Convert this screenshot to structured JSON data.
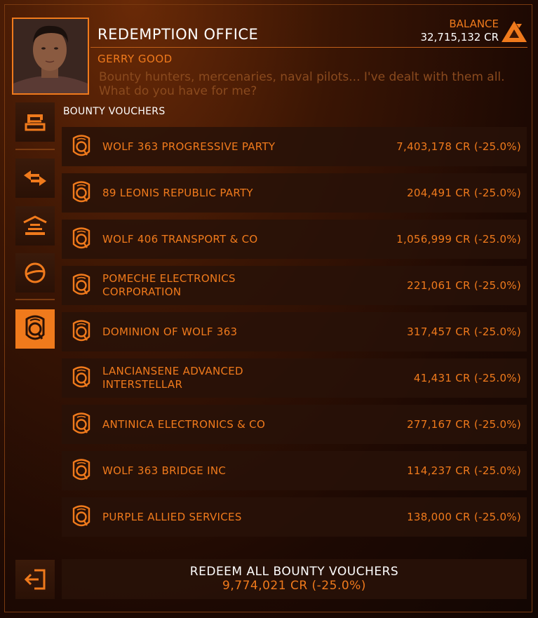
{
  "header": {
    "title": "REDEMPTION OFFICE",
    "balance_label": "BALANCE",
    "balance_value": "32,715,132 CR",
    "contact_name": "GERRY GOOD",
    "contact_quote": "Bounty hunters, mercenaries, naval pilots... I've dealt with them all. What do you have for me?",
    "faction_icon": "triangle-faction-icon"
  },
  "section_label": "BOUNTY VOUCHERS",
  "nav": {
    "items": [
      {
        "icon": "vouchers-stack-icon",
        "active": false
      },
      {
        "icon": "transfer-arrows-icon",
        "active": false
      },
      {
        "icon": "stage-ramp-icon",
        "active": false
      },
      {
        "icon": "orbit-circle-icon",
        "active": false
      },
      {
        "icon": "bounty-badge-icon",
        "active": true
      }
    ],
    "exit_icon": "exit-door-icon"
  },
  "vouchers": [
    {
      "name": "WOLF 363 PROGRESSIVE PARTY",
      "amount": "7,403,178 CR (-25.0%)"
    },
    {
      "name": "89 LEONIS REPUBLIC PARTY",
      "amount": "204,491 CR (-25.0%)"
    },
    {
      "name": "WOLF 406 TRANSPORT & CO",
      "amount": "1,056,999 CR (-25.0%)"
    },
    {
      "name": "POMECHE ELECTRONICS CORPORATION",
      "amount": "221,061 CR (-25.0%)"
    },
    {
      "name": "DOMINION OF WOLF 363",
      "amount": "317,457 CR (-25.0%)"
    },
    {
      "name": "LANCIANSENE ADVANCED INTERSTELLAR",
      "amount": "41,431 CR (-25.0%)"
    },
    {
      "name": "ANTINICA ELECTRONICS & CO",
      "amount": "277,167 CR (-25.0%)"
    },
    {
      "name": "WOLF 363 BRIDGE INC",
      "amount": "114,237 CR (-25.0%)"
    },
    {
      "name": "PURPLE ALLIED SERVICES",
      "amount": "138,000 CR (-25.0%)"
    }
  ],
  "redeem": {
    "label": "REDEEM ALL BOUNTY VOUCHERS",
    "amount": "9,774,021 CR (-25.0%)"
  },
  "colors": {
    "accent": "#f07a1c",
    "background": "#1d0903",
    "highlight_text": "#ffffff"
  }
}
